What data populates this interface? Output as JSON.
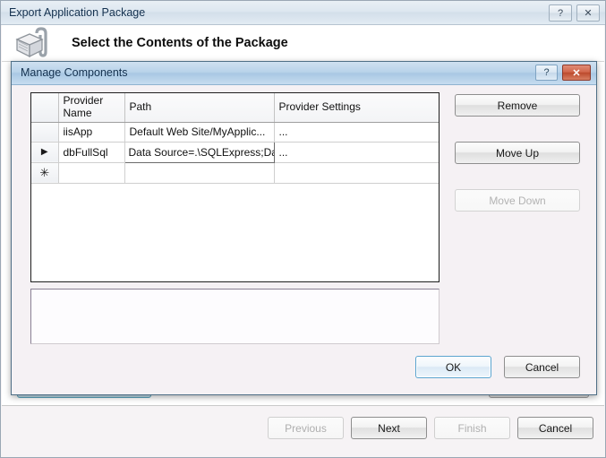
{
  "outer_window": {
    "title": "Export Application Package",
    "help_label": "?",
    "close_label": "✕",
    "header_title": "Select the Contents of the Package",
    "package_icon": "package-box-icon",
    "background_buttons": [
      {
        "label": "",
        "name": "manage-components-button-occluded"
      },
      {
        "label": "",
        "name": "secondary-button-occluded"
      }
    ],
    "footer_buttons": [
      {
        "label": "Previous",
        "name": "previous-button",
        "disabled": true
      },
      {
        "label": "Next",
        "name": "next-button",
        "disabled": false
      },
      {
        "label": "Finish",
        "name": "finish-button",
        "disabled": true
      },
      {
        "label": "Cancel",
        "name": "cancel-button",
        "disabled": false
      }
    ]
  },
  "modal": {
    "title": "Manage Components",
    "help_label": "?",
    "close_label": "✕",
    "grid": {
      "columns": [
        "",
        "Provider Name",
        "Path",
        "Provider Settings"
      ],
      "rows": [
        {
          "marker": "",
          "provider_name": "iisApp",
          "path": "Default Web Site/MyApplic...",
          "provider_settings": "...",
          "selected": false,
          "editing": false
        },
        {
          "marker": "▶",
          "provider_name": "dbFullSql",
          "path": "Data Source=.\\SQLExpress;Dat",
          "provider_settings": "...",
          "selected": true,
          "editing": true
        },
        {
          "marker": "✳",
          "provider_name": "",
          "path": "",
          "provider_settings": "",
          "selected": false,
          "editing": false
        }
      ]
    },
    "side_buttons": [
      {
        "label": "Remove",
        "name": "remove-button",
        "disabled": false
      },
      {
        "label": "Move Up",
        "name": "move-up-button",
        "disabled": false
      },
      {
        "label": "Move Down",
        "name": "move-down-button",
        "disabled": true
      }
    ],
    "footer_buttons": [
      {
        "label": "OK",
        "name": "ok-button",
        "default": true
      },
      {
        "label": "Cancel",
        "name": "cancel-button",
        "default": false
      }
    ],
    "description_panel_text": ""
  },
  "colors": {
    "selection_blue": "#2196f3",
    "titlebar_blue": "#b9d3ea",
    "close_red": "#bd4b2d",
    "dialog_bg": "#f5f1f4"
  }
}
